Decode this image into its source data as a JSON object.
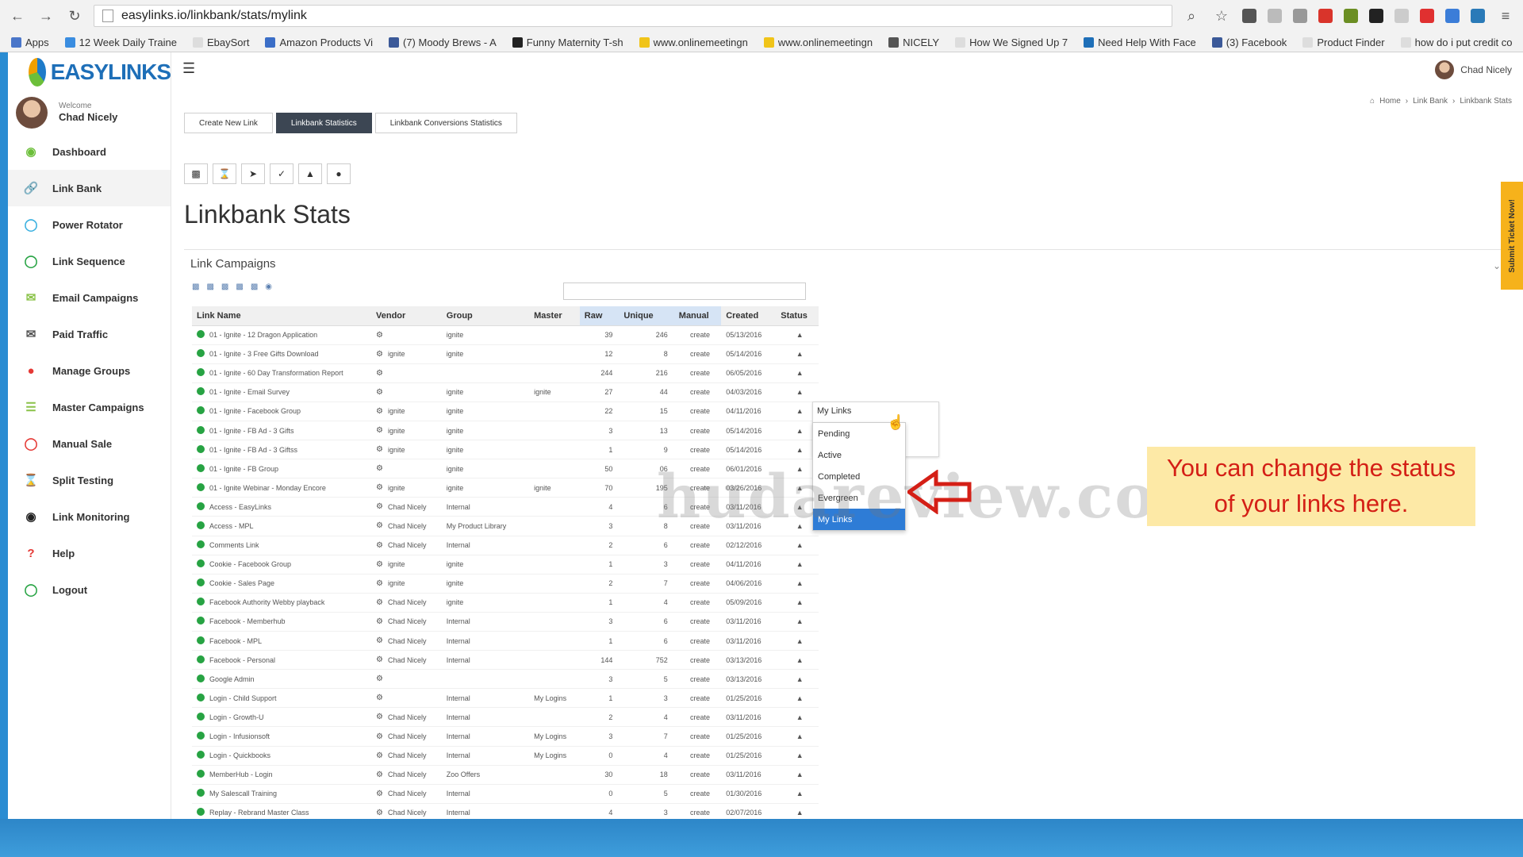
{
  "browser": {
    "url": "easylinks.io/linkbank/stats/mylink",
    "bookmarks": [
      "Apps",
      "12 Week Daily Traine",
      "EbaySort",
      "Amazon Products Vi",
      "(7) Moody Brews - A",
      "Funny Maternity T-sh",
      "www.onlinemeetingn",
      "www.onlinemeetingn",
      "NICELY",
      "How We Signed Up 7",
      "Need Help With Face",
      "(3) Facebook",
      "Product Finder",
      "how do i put credit co"
    ]
  },
  "app": {
    "logo_text": "EASYLINKS",
    "welcome_label": "Welcome",
    "user_name": "Chad Nicely"
  },
  "sidebar": {
    "items": [
      {
        "label": "Dashboard",
        "icon": "dashboard-icon"
      },
      {
        "label": "Link Bank",
        "icon": "link-icon"
      },
      {
        "label": "Power Rotator",
        "icon": "rotator-icon"
      },
      {
        "label": "Link Sequence",
        "icon": "sequence-icon"
      },
      {
        "label": "Email Campaigns",
        "icon": "email-icon"
      },
      {
        "label": "Paid Traffic",
        "icon": "mail-icon"
      },
      {
        "label": "Manage Groups",
        "icon": "groups-icon"
      },
      {
        "label": "Master Campaigns",
        "icon": "list-icon"
      },
      {
        "label": "Manual Sale",
        "icon": "power-icon"
      },
      {
        "label": "Split Testing",
        "icon": "hourglass-icon"
      },
      {
        "label": "Link Monitoring",
        "icon": "globe-icon"
      },
      {
        "label": "Help",
        "icon": "question-icon"
      },
      {
        "label": "Logout",
        "icon": "logout-icon"
      }
    ]
  },
  "header": {
    "user_name": "Chad Nicely",
    "breadcrumb": [
      "Home",
      "Link Bank",
      "Linkbank Stats"
    ]
  },
  "tabs": [
    "Create New Link",
    "Linkbank Statistics",
    "Linkbank Conversions Statistics"
  ],
  "page_title": "Linkbank Stats",
  "panel_title": "Link Campaigns",
  "table": {
    "columns": [
      "Link Name",
      "Vendor",
      "Group",
      "Master",
      "Raw",
      "Unique",
      "Manual",
      "Created",
      "Status"
    ],
    "rows": [
      [
        "01 - Ignite - 12 Dragon Application",
        "",
        "ignite",
        "",
        "39",
        "246",
        "create",
        "05/13/2016"
      ],
      [
        "01 - Ignite - 3 Free Gifts Download",
        "ignite",
        "ignite",
        "",
        "12",
        "8",
        "create",
        "05/14/2016"
      ],
      [
        "01 - Ignite - 60 Day Transformation Report",
        "",
        "",
        "",
        "244",
        "216",
        "create",
        "06/05/2016"
      ],
      [
        "01 - Ignite - Email Survey",
        "",
        "ignite",
        "ignite",
        "27",
        "44",
        "create",
        "04/03/2016"
      ],
      [
        "01 - Ignite - Facebook Group",
        "ignite",
        "ignite",
        "",
        "22",
        "15",
        "create",
        "04/11/2016"
      ],
      [
        "01 - Ignite - FB Ad - 3 Gifts",
        "ignite",
        "ignite",
        "",
        "3",
        "13",
        "create",
        "05/14/2016"
      ],
      [
        "01 - Ignite - FB Ad - 3 Giftss",
        "ignite",
        "ignite",
        "",
        "1",
        "9",
        "create",
        "05/14/2016"
      ],
      [
        "01 - Ignite - FB Group",
        "",
        "ignite",
        "",
        "50",
        "06",
        "create",
        "06/01/2016"
      ],
      [
        "01 - Ignite Webinar - Monday Encore",
        "ignite",
        "ignite",
        "ignite",
        "70",
        "195",
        "create",
        "03/26/2016"
      ],
      [
        "Access - EasyLinks",
        "Chad Nicely",
        "Internal",
        "",
        "4",
        "6",
        "create",
        "03/11/2016"
      ],
      [
        "Access - MPL",
        "Chad Nicely",
        "My Product Library",
        "",
        "3",
        "8",
        "create",
        "03/11/2016"
      ],
      [
        "Comments Link",
        "Chad Nicely",
        "Internal",
        "",
        "2",
        "6",
        "create",
        "02/12/2016"
      ],
      [
        "Cookie - Facebook Group",
        "ignite",
        "ignite",
        "",
        "1",
        "3",
        "create",
        "04/11/2016"
      ],
      [
        "Cookie - Sales Page",
        "ignite",
        "ignite",
        "",
        "2",
        "7",
        "create",
        "04/06/2016"
      ],
      [
        "Facebook Authority Webby playback",
        "Chad Nicely",
        "ignite",
        "",
        "1",
        "4",
        "create",
        "05/09/2016"
      ],
      [
        "Facebook - Memberhub",
        "Chad Nicely",
        "Internal",
        "",
        "3",
        "6",
        "create",
        "03/11/2016"
      ],
      [
        "Facebook - MPL",
        "Chad Nicely",
        "Internal",
        "",
        "1",
        "6",
        "create",
        "03/11/2016"
      ],
      [
        "Facebook - Personal",
        "Chad Nicely",
        "Internal",
        "",
        "144",
        "752",
        "create",
        "03/13/2016"
      ],
      [
        "Google Admin",
        "",
        "",
        "",
        "3",
        "5",
        "create",
        "03/13/2016"
      ],
      [
        "Login - Child Support",
        "",
        "Internal",
        "My Logins",
        "1",
        "3",
        "create",
        "01/25/2016"
      ],
      [
        "Login - Growth-U",
        "Chad Nicely",
        "Internal",
        "",
        "2",
        "4",
        "create",
        "03/11/2016"
      ],
      [
        "Login - Infusionsoft",
        "Chad Nicely",
        "Internal",
        "My Logins",
        "3",
        "7",
        "create",
        "01/25/2016"
      ],
      [
        "Login - Quickbooks",
        "Chad Nicely",
        "Internal",
        "My Logins",
        "0",
        "4",
        "create",
        "01/25/2016"
      ],
      [
        "MemberHub - Login",
        "Chad Nicely",
        "Zoo Offers",
        "",
        "30",
        "18",
        "create",
        "03/11/2016"
      ],
      [
        "My Salescall Training",
        "Chad Nicely",
        "Internal",
        "",
        "0",
        "5",
        "create",
        "01/30/2016"
      ],
      [
        "Replay - Rebrand Master Class",
        "Chad Nicely",
        "Internal",
        "",
        "4",
        "3",
        "create",
        "02/07/2016"
      ]
    ]
  },
  "status_dropdown": {
    "current": "My Links",
    "options": [
      "Pending",
      "Active",
      "Completed",
      "Evergreen",
      "My Links"
    ],
    "selected": "My Links"
  },
  "watermark": "hudareview.com",
  "callout": "You can change the status of your links here.",
  "ticket_tab": "Submit Ticket Now!",
  "colors": {
    "accent": "#2e7cd6",
    "callout_bg": "#fde9a6",
    "callout_text": "#d41f16",
    "status_ok": "#27a343",
    "ticket_tab": "#f6b21b"
  }
}
